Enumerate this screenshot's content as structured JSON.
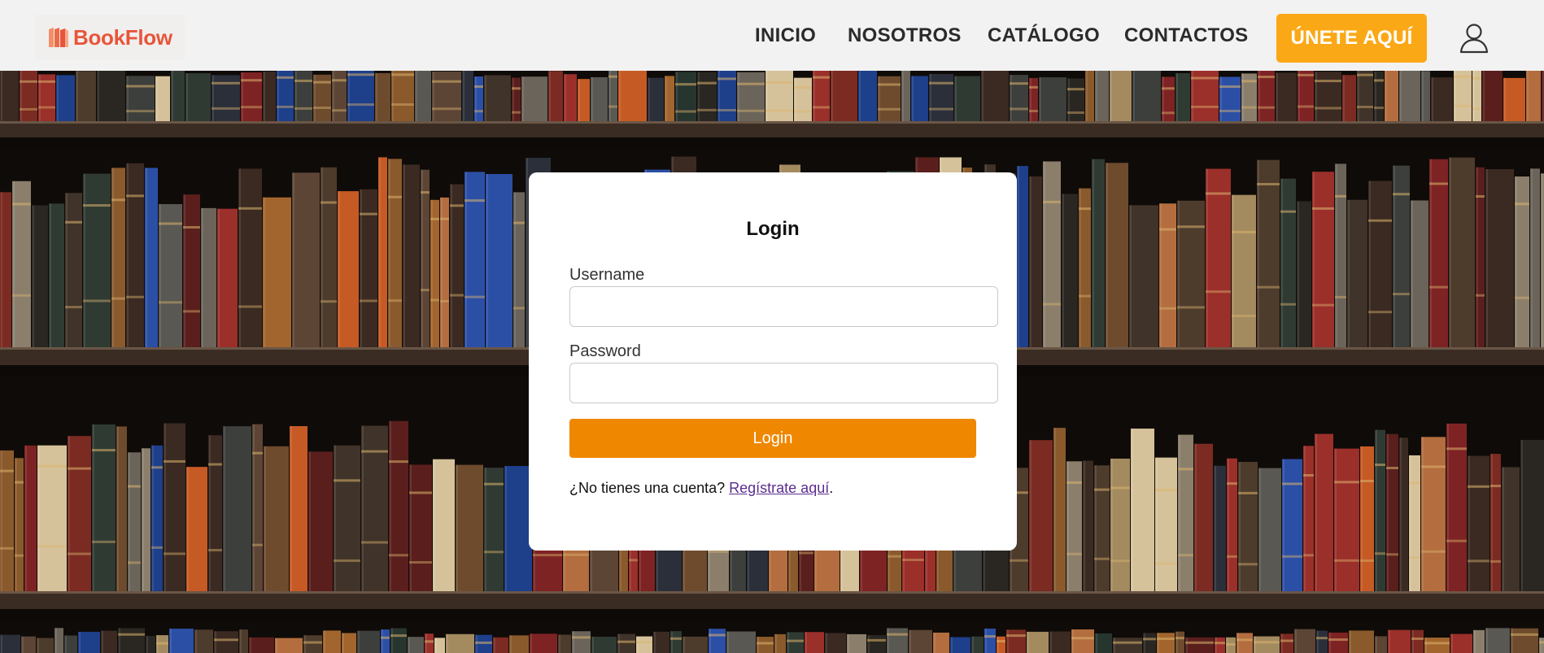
{
  "brand": {
    "name": "BookFlow",
    "icon": "book-stack-logo-icon",
    "color": "#e8553a"
  },
  "nav": {
    "items": [
      {
        "label": "INICIO"
      },
      {
        "label": "NOSOTROS"
      },
      {
        "label": "CATÁLOGO"
      },
      {
        "label": "CONTACTOS"
      }
    ],
    "cta_label": "ÚNETE AQUÍ",
    "cta_color": "#fba817",
    "user_icon": "user-icon"
  },
  "background": {
    "description_icon": "bookshelf-background"
  },
  "login": {
    "title": "Login",
    "username_label": "Username",
    "username_value": "",
    "password_label": "Password",
    "password_value": "",
    "submit_label": "Login",
    "submit_color": "#ef8700",
    "signup_prompt": "¿No tienes una cuenta? ",
    "signup_link": "Regístrate aquí",
    "signup_suffix": "."
  }
}
